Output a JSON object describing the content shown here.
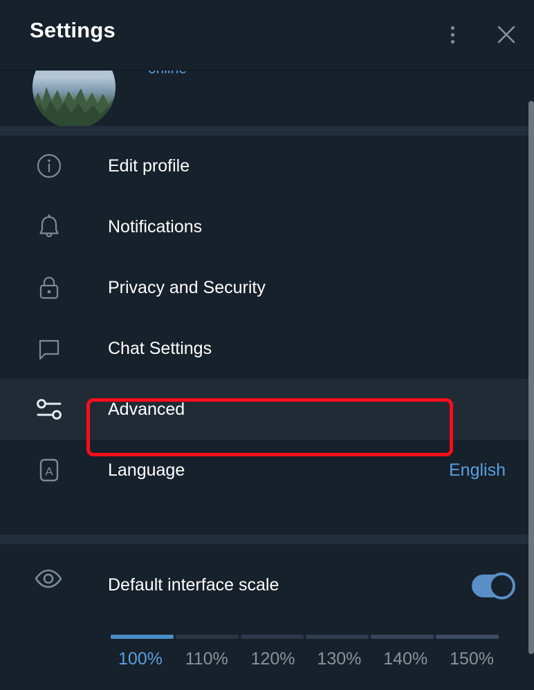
{
  "header": {
    "title": "Settings",
    "menu_icon": "three-dots-vertical-icon",
    "close_icon": "close-icon"
  },
  "profile": {
    "status": "online",
    "avatar_icon": "user-avatar-photo"
  },
  "menu": {
    "items": [
      {
        "label": "Edit profile",
        "icon": "info-circle-icon",
        "value": "",
        "active": false
      },
      {
        "label": "Notifications",
        "icon": "bell-icon",
        "value": "",
        "active": false
      },
      {
        "label": "Privacy and Security",
        "icon": "lock-icon",
        "value": "",
        "active": false
      },
      {
        "label": "Chat Settings",
        "icon": "chat-bubble-icon",
        "value": "",
        "active": false
      },
      {
        "label": "Advanced",
        "icon": "sliders-icon",
        "value": "",
        "active": true
      },
      {
        "label": "Language",
        "icon": "letter-a-box-icon",
        "value": "English",
        "active": false
      }
    ]
  },
  "scale": {
    "label": "Default interface scale",
    "icon": "eye-icon",
    "toggle_on": true,
    "selected_index": 0,
    "options": [
      "100%",
      "110%",
      "120%",
      "130%",
      "140%",
      "150%"
    ]
  },
  "colors": {
    "background": "#17212b",
    "divider": "#232e3c",
    "row_active": "#202b36",
    "accent_blue": "#5a9fe0",
    "toggle_blue": "#5a8fc7",
    "highlight_red": "#fb0d1b",
    "icon_gray": "#7d8b99",
    "text_white": "#ffffff",
    "scrollbar": "#6d767f"
  }
}
